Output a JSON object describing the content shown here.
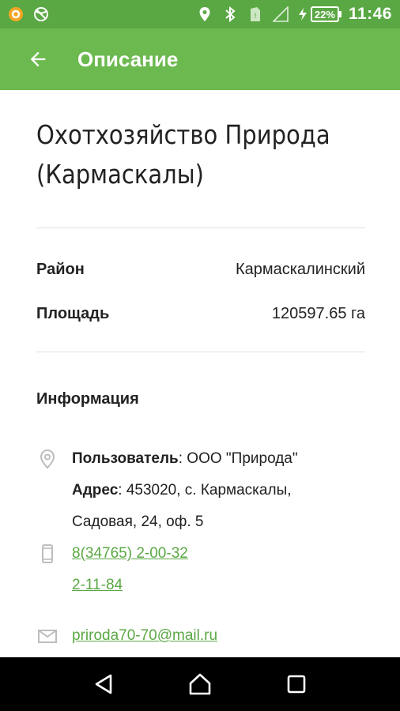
{
  "status_bar": {
    "battery_percent": "22%",
    "time": "11:46",
    "icons": [
      "app-notification-icon",
      "blocked-globe-icon",
      "location-icon",
      "bluetooth-icon",
      "sim-card-icon",
      "signal-icon",
      "charging-icon",
      "battery-icon"
    ]
  },
  "app_bar": {
    "title": "Описание",
    "back_icon": "arrow-back-icon"
  },
  "detail": {
    "name": "Охотхозяйство Природа (Кармаскалы)",
    "rows": [
      {
        "label": "Район",
        "value": "Кармаскалинский"
      },
      {
        "label": "Площадь",
        "value": "120597.65 га"
      }
    ],
    "info_header": "Информация",
    "user_label": "Пользователь",
    "user_value": ": ООО \"Природа\"",
    "address_label": "Адрес",
    "address_line1": ": 453020, с. Кармаскалы,",
    "address_line2": "Садовая, 24, оф. 5",
    "phone1": "8(34765) 2-00-32",
    "phone2": "2-11-84",
    "email": "priroda70-70@mail.ru"
  },
  "nav_bar": {
    "back": "triangle-back-icon",
    "home": "home-icon",
    "recents": "recents-icon"
  }
}
